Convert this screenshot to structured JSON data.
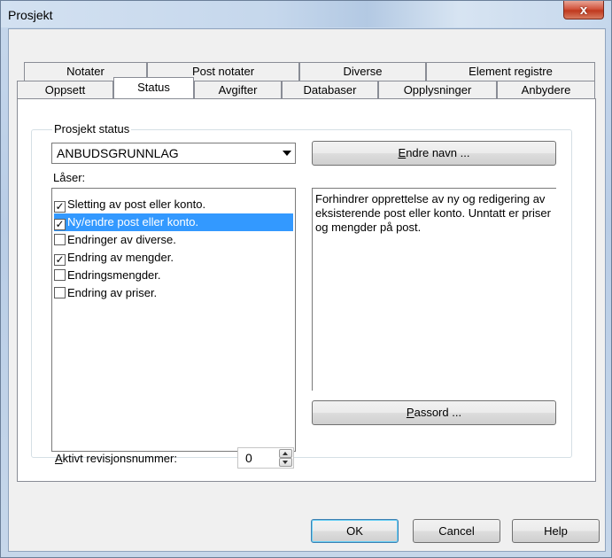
{
  "window": {
    "title": "Prosjekt",
    "close_label": "x"
  },
  "tabs_row1": [
    {
      "label": "Notater"
    },
    {
      "label": "Post notater"
    },
    {
      "label": "Diverse"
    },
    {
      "label": "Element registre"
    }
  ],
  "tabs_row2": [
    {
      "label": "Oppsett"
    },
    {
      "label": "Status",
      "active": true
    },
    {
      "label": "Avgifter"
    },
    {
      "label": "Databaser"
    },
    {
      "label": "Opplysninger"
    },
    {
      "label": "Anbydere"
    }
  ],
  "status": {
    "group_label": "Prosjekt status",
    "combo_value": "ANBUDSGRUNNLAG",
    "rename_button": {
      "prefix": "",
      "accel": "E",
      "rest": "ndre navn ..."
    },
    "laser_label": "Låser:",
    "lock_items": [
      {
        "label": "Sletting av post eller konto.",
        "checked": true,
        "selected": false
      },
      {
        "label": "Ny/endre post eller konto.",
        "checked": true,
        "selected": true
      },
      {
        "label": "Endringer av diverse.",
        "checked": false,
        "selected": false
      },
      {
        "label": "Endring av mengder.",
        "checked": true,
        "selected": false
      },
      {
        "label": "Endringsmengder.",
        "checked": false,
        "selected": false
      },
      {
        "label": "Endring av priser.",
        "checked": false,
        "selected": false
      }
    ],
    "description": "Forhindrer opprettelse av ny og redigering av eksisterende post eller konto. Unntatt er priser og mengder på post.",
    "password_button": {
      "accel": "P",
      "rest": "assord ..."
    },
    "revision_label": {
      "accel": "A",
      "rest": "ktivt revisjonsnummer:"
    },
    "revision_value": "0"
  },
  "buttons": {
    "ok": "OK",
    "cancel": "Cancel",
    "help": "Help"
  },
  "colors": {
    "selection": "#3399ff",
    "close_button": "#c0391e",
    "window_frame": "#b9cde6"
  }
}
